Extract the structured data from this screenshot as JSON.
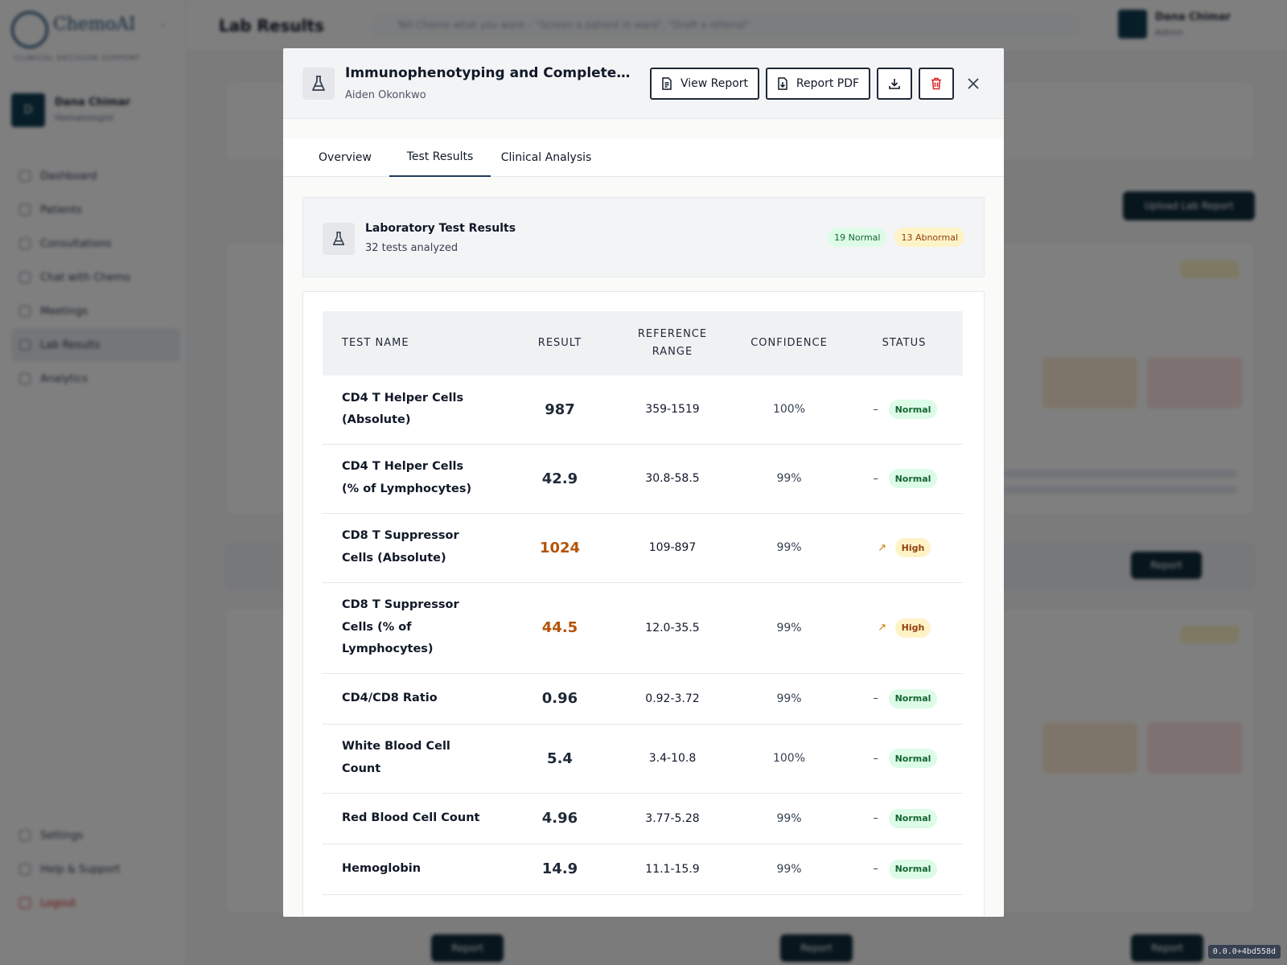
{
  "background": {
    "logo_text": "ChemoAI",
    "logo_sub": "CLINICAL DECISION SUPPORT",
    "user": {
      "initial": "D",
      "name": "Dana Chimar",
      "role": "Hematologist"
    },
    "nav": [
      {
        "label": "Dashboard"
      },
      {
        "label": "Patients"
      },
      {
        "label": "Consultations"
      },
      {
        "label": "Chat with Chemo"
      },
      {
        "label": "Meetings"
      },
      {
        "label": "Lab Results"
      },
      {
        "label": "Analytics"
      }
    ],
    "nav_bottom": [
      {
        "label": "Settings"
      },
      {
        "label": "Help & Support"
      },
      {
        "label": "Logout"
      }
    ],
    "page_title": "Lab Results",
    "command_placeholder": "Tell Chemo what you want – \"Screen a patient in ward\", \"Draft a referral\"",
    "top_user": {
      "name": "Dana Chimar",
      "role": "Admin"
    },
    "report_label": "Report",
    "upload_label": "Upload Lab Report",
    "version": "0.0.0+4bd558d"
  },
  "modal": {
    "title": "Immunophenotyping and Complete Blood Count",
    "patient": "Aiden Okonkwo",
    "buttons": {
      "view_report": "View Report",
      "report_pdf": "Report PDF"
    },
    "tabs": [
      {
        "label": "Overview"
      },
      {
        "label": "Test Results"
      },
      {
        "label": "Clinical Analysis"
      }
    ],
    "active_tab": "Test Results",
    "summary": {
      "title": "Laboratory Test Results",
      "subtitle": "32 tests analyzed",
      "normal_badge": "19 Normal",
      "abnormal_badge": "13 Abnormal"
    },
    "table": {
      "headers": {
        "name": "Test Name",
        "result": "Result",
        "reference_line1": "Reference",
        "reference_line2": "Range",
        "confidence": "Confidence",
        "status": "Status"
      },
      "rows": [
        {
          "name_l1": "CD4 T Helper Cells",
          "name_l2": "(Absolute)",
          "name_l3": "",
          "result": "987",
          "reference": "359-1519",
          "confidence": "100%",
          "status": "Normal",
          "trend": "–"
        },
        {
          "name_l1": "CD4 T Helper Cells",
          "name_l2": "(% of Lymphocytes)",
          "name_l3": "",
          "result": "42.9",
          "reference": "30.8-58.5",
          "confidence": "99%",
          "status": "Normal",
          "trend": "–"
        },
        {
          "name_l1": "CD8 T Suppressor",
          "name_l2": "Cells (Absolute)",
          "name_l3": "",
          "result": "1024",
          "reference": "109-897",
          "confidence": "99%",
          "status": "High",
          "trend": "↗"
        },
        {
          "name_l1": "CD8 T Suppressor",
          "name_l2": "Cells (% of",
          "name_l3": "Lymphocytes)",
          "result": "44.5",
          "reference": "12.0-35.5",
          "confidence": "99%",
          "status": "High",
          "trend": "↗"
        },
        {
          "name_l1": "CD4/CD8 Ratio",
          "name_l2": "",
          "name_l3": "",
          "result": "0.96",
          "reference": "0.92-3.72",
          "confidence": "99%",
          "status": "Normal",
          "trend": "–"
        },
        {
          "name_l1": "White Blood Cell",
          "name_l2": "Count",
          "name_l3": "",
          "result": "5.4",
          "reference": "3.4-10.8",
          "confidence": "100%",
          "status": "Normal",
          "trend": "–"
        },
        {
          "name_l1": "Red Blood Cell Count",
          "name_l2": "",
          "name_l3": "",
          "result": "4.96",
          "reference": "3.77-5.28",
          "confidence": "99%",
          "status": "Normal",
          "trend": "–"
        },
        {
          "name_l1": "Hemoglobin",
          "name_l2": "",
          "name_l3": "",
          "result": "14.9",
          "reference": "11.1-15.9",
          "confidence": "99%",
          "status": "Normal",
          "trend": "–"
        }
      ]
    }
  },
  "colors": {
    "normal_bg": "#dcfce7",
    "normal_text": "#166534",
    "high_bg": "#fef3c7",
    "high_text": "#92400e",
    "high_value": "#b45309",
    "accent": "#1f3b57"
  }
}
